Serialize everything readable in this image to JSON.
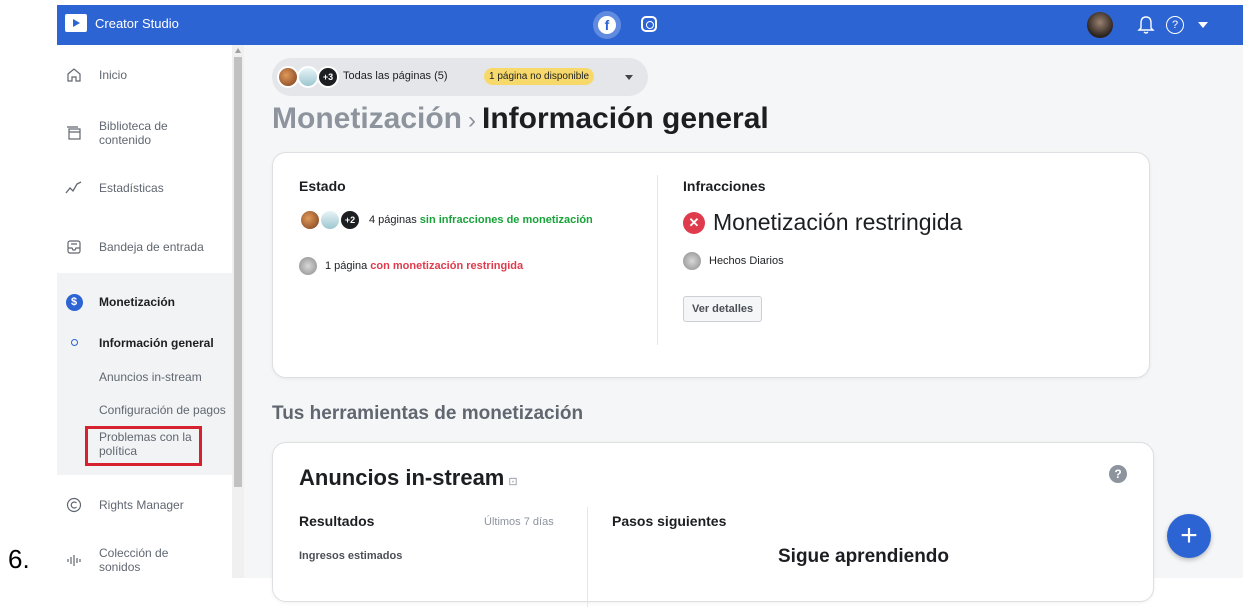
{
  "step_number": "6.",
  "topbar": {
    "app_title": "Creator Studio",
    "facebook_icon": "facebook-icon",
    "instagram_icon": "instagram-icon",
    "help_label": "?"
  },
  "sidebar": {
    "items": [
      {
        "label": "Inicio",
        "icon": "home-icon"
      },
      {
        "label": "Biblioteca de contenido",
        "icon": "content-library-icon"
      },
      {
        "label": "Estadísticas",
        "icon": "insights-icon"
      },
      {
        "label": "Bandeja de entrada",
        "icon": "inbox-icon"
      },
      {
        "label": "Monetización",
        "icon": "money-icon"
      },
      {
        "label": "Rights Manager",
        "icon": "copyright-icon"
      },
      {
        "label": "Colección de sonidos",
        "icon": "sound-icon"
      }
    ],
    "sub_items": [
      {
        "label": "Información general"
      },
      {
        "label": "Anuncios in-stream"
      },
      {
        "label": "Configuración de pagos"
      },
      {
        "label": "Problemas con la política"
      }
    ]
  },
  "main": {
    "page_selector": {
      "label": "Todas las páginas (5)",
      "badge": "1 página no disponible",
      "more_count": "+3"
    },
    "breadcrumb": {
      "parent": "Monetización",
      "separator": "›",
      "current": "Información general"
    },
    "status_card": {
      "estado_title": "Estado",
      "pages_ok_count": "4 páginas",
      "pages_ok_text": "sin infracciones de monetización",
      "pages_restricted_count": "1 página",
      "pages_restricted_text": "con monetización restringida",
      "avatar_more": "+2",
      "infracciones_title": "Infracciones",
      "restriction_status": "Monetización restringida",
      "page_name": "Hechos Diarios",
      "details_button": "Ver detalles"
    },
    "tools_section_title": "Tus herramientas de monetización",
    "instream_card": {
      "title": "Anuncios in-stream",
      "results_title": "Resultados",
      "period": "Últimos 7 días",
      "revenue_label": "Ingresos estimados",
      "next_steps_title": "Pasos siguientes",
      "keep_learning": "Sigue aprendiendo",
      "help_label": "?"
    },
    "fab_label": "+"
  },
  "colors": {
    "brand_blue": "#2d64d3",
    "success_green": "#18a33a",
    "error_red": "#e03b4c",
    "warning_yellow": "#f7d96b",
    "highlight_red": "#d6212f"
  }
}
